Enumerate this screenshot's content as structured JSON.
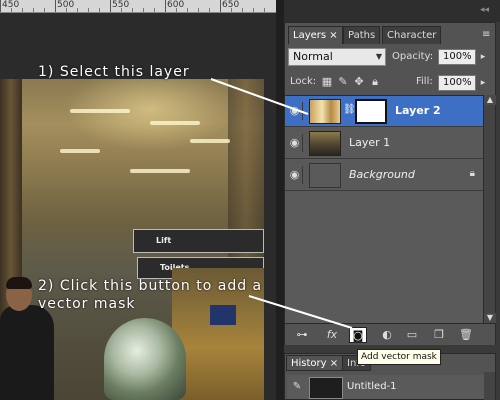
{
  "ruler": {
    "labels": [
      "450",
      "500",
      "550",
      "600",
      "650"
    ]
  },
  "canvas": {
    "signs": [
      "Lift",
      "Toilets"
    ],
    "annotation_1": "1) Select this layer",
    "annotation_2": "2) Click this button to add a vector mask"
  },
  "layers_panel": {
    "tabs": [
      {
        "label": "Layers ×",
        "active": true
      },
      {
        "label": "Paths",
        "active": false
      },
      {
        "label": "Character",
        "active": false
      }
    ],
    "menu_icon": "panel-menu-icon",
    "blend_mode": "Normal",
    "opacity_label": "Opacity:",
    "opacity_value": "100%",
    "lock_label": "Lock:",
    "fill_label": "Fill:",
    "fill_value": "100%",
    "layers": [
      {
        "name": "Layer 2",
        "selected": true,
        "visible": true,
        "has_mask": true
      },
      {
        "name": "Layer 1",
        "selected": false,
        "visible": true,
        "has_mask": false
      },
      {
        "name": "Background",
        "selected": false,
        "visible": true,
        "locked": true,
        "italic": true
      }
    ],
    "footer_icons": [
      "link-layers-icon",
      "fx-icon",
      "add-mask-icon",
      "adjustment-layer-icon",
      "new-group-icon",
      "new-layer-icon",
      "trash-icon"
    ],
    "tooltip": "Add vector mask"
  },
  "history_panel": {
    "tabs": [
      {
        "label": "History ×",
        "active": true
      },
      {
        "label": "Info",
        "active": false
      }
    ],
    "entries": [
      {
        "name": "Untitled-1"
      }
    ]
  },
  "colors": {
    "selection": "#3d6fc4",
    "panel_bg": "#535353",
    "annotation_text": "#ffffff"
  }
}
